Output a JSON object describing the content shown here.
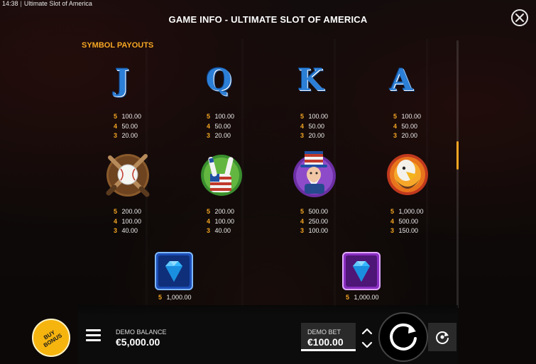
{
  "window": {
    "time": "14:38",
    "title": "Ultimate Slot of America"
  },
  "dialog": {
    "title": "GAME INFO - ULTIMATE SLOT OF AMERICA",
    "close_icon": "close-icon"
  },
  "section": {
    "heading": "SYMBOL PAYOUTS"
  },
  "symbols": [
    {
      "name": "J",
      "label": "J",
      "icon": "letter-j-icon",
      "payouts": [
        {
          "count": "5",
          "value": "100.00"
        },
        {
          "count": "4",
          "value": "50.00"
        },
        {
          "count": "3",
          "value": "20.00"
        }
      ]
    },
    {
      "name": "Q",
      "label": "Q",
      "icon": "letter-q-icon",
      "payouts": [
        {
          "count": "5",
          "value": "100.00"
        },
        {
          "count": "4",
          "value": "50.00"
        },
        {
          "count": "3",
          "value": "20.00"
        }
      ]
    },
    {
      "name": "K",
      "label": "K",
      "icon": "letter-k-icon",
      "payouts": [
        {
          "count": "5",
          "value": "100.00"
        },
        {
          "count": "4",
          "value": "50.00"
        },
        {
          "count": "3",
          "value": "20.00"
        }
      ]
    },
    {
      "name": "A",
      "label": "A",
      "icon": "letter-a-icon",
      "payouts": [
        {
          "count": "5",
          "value": "100.00"
        },
        {
          "count": "4",
          "value": "50.00"
        },
        {
          "count": "3",
          "value": "20.00"
        }
      ]
    },
    {
      "name": "baseball",
      "icon": "baseball-bats-icon",
      "payouts": [
        {
          "count": "5",
          "value": "200.00"
        },
        {
          "count": "4",
          "value": "100.00"
        },
        {
          "count": "3",
          "value": "40.00"
        }
      ]
    },
    {
      "name": "rock-hand",
      "icon": "rock-hand-icon",
      "payouts": [
        {
          "count": "5",
          "value": "200.00"
        },
        {
          "count": "4",
          "value": "100.00"
        },
        {
          "count": "3",
          "value": "40.00"
        }
      ]
    },
    {
      "name": "uncle-sam",
      "icon": "uncle-sam-icon",
      "payouts": [
        {
          "count": "5",
          "value": "500.00"
        },
        {
          "count": "4",
          "value": "250.00"
        },
        {
          "count": "3",
          "value": "100.00"
        }
      ]
    },
    {
      "name": "eagle",
      "icon": "eagle-icon",
      "payouts": [
        {
          "count": "5",
          "value": "1,000.00"
        },
        {
          "count": "4",
          "value": "500.00"
        },
        {
          "count": "3",
          "value": "150.00"
        }
      ]
    },
    {
      "name": "blue-diamond",
      "icon": "blue-diamond-icon",
      "payouts": [
        {
          "count": "5",
          "value": "1,000.00"
        }
      ]
    },
    {
      "name": "purple-diamond",
      "icon": "purple-diamond-icon",
      "payouts": [
        {
          "count": "5",
          "value": "1,000.00"
        }
      ]
    }
  ],
  "colors": {
    "accent": "#f5a623",
    "letter_blue": "#2c7fd6",
    "buy_bonus": "#f6b40f"
  },
  "controls": {
    "buy_bonus_label": "BUY BONUS",
    "balance_label": "DEMO BALANCE",
    "balance_value": "€5,000.00",
    "bet_label": "DEMO BET",
    "bet_value": "€100.00",
    "menu_icon": "menu-icon",
    "spin_icon": "spin-icon",
    "autoplay_icon": "autoplay-icon"
  }
}
